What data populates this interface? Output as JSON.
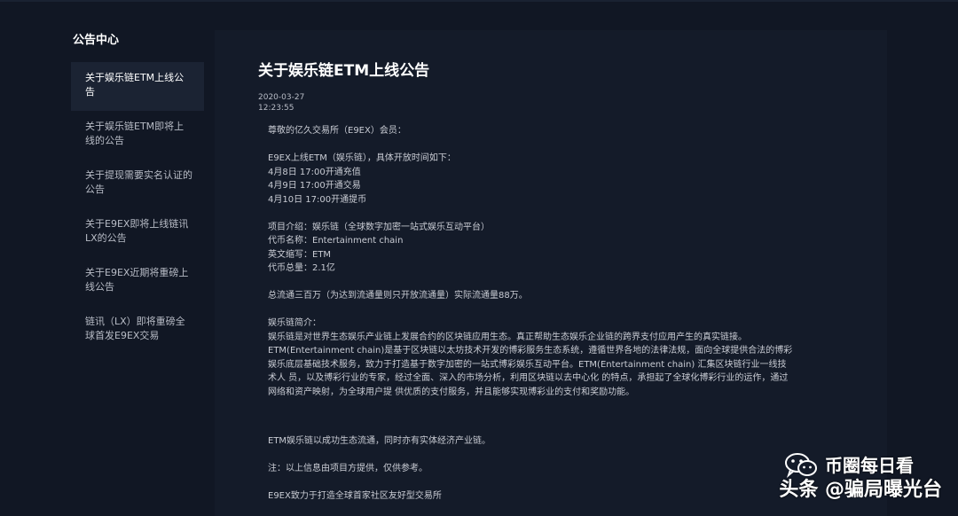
{
  "sidebar": {
    "title": "公告中心",
    "items": [
      {
        "label": "关于娱乐链ETM上线公告",
        "active": true
      },
      {
        "label": "关于娱乐链ETM即将上线的公告",
        "active": false
      },
      {
        "label": "关于提现需要实名认证的公告",
        "active": false
      },
      {
        "label": "关于E9EX即将上线链讯LX的公告",
        "active": false
      },
      {
        "label": "关于E9EX近期将重磅上线公告",
        "active": false
      },
      {
        "label": "链讯（LX）即将重磅全球首发E9EX交易",
        "active": false
      }
    ]
  },
  "article": {
    "title": "关于娱乐链ETM上线公告",
    "date": "2020-03-27",
    "time": "12:23:55",
    "greeting": "尊敬的亿久交易所（E9EX）会员：",
    "launch_intro": "E9EX上线ETM（娱乐链），具体开放时间如下：",
    "launch_1": "4月8日 17:00开通充值",
    "launch_2": "4月9日 17:00开通交易",
    "launch_3": "4月10日 17:00开通提币",
    "project": "项目介绍：娱乐链（全球数字加密一站式娱乐互动平台）",
    "token_name": "代币名称：Entertainment chain",
    "abbr": "英文缩写：ETM",
    "total": "代币总量：2.1亿",
    "circulation": "总流通三百万（为达到流通量则只开放流通量）实际流通量88万。",
    "intro_heading": "娱乐链简介：",
    "intro_1": "娱乐链是对世界生态娱乐产业链上发展合约的区块链应用生态。真正帮助生态娱乐企业链的跨界支付应用产生的真实链接。",
    "intro_2": "ETM(Entertainment chain)是基于区块链以太坊技术开发的博彩服务生态系统，遵循世界各地的法律法规，面向全球提供合法的博彩",
    "intro_3": "娱乐底层基础技术服务，致力于打造基于数字加密的一站式博彩娱乐互动平台。ETM(Entertainment chain) 汇集区块链行业一线技",
    "intro_4": "术人 员，以及博彩行业的专家，经过全面、深入的市场分析，利用区块链以去中心化 的特点，承担起了全球化博彩行业的运作，通过",
    "intro_5": "网络和资产映射，为全球用户提 供优质的支付服务，并且能够实现博彩业的支付和奖励功能。",
    "ecosystem": "ETM娱乐链以成功生态流通，同时亦有实体经济产业链。",
    "note": "注：以上信息由项目方提供，仅供参考。",
    "signature": "E9EX致力于打造全球首家社区友好型交易所"
  },
  "watermark": {
    "channel": "币圈每日看",
    "line2": "头条 @骗局曝光台"
  }
}
